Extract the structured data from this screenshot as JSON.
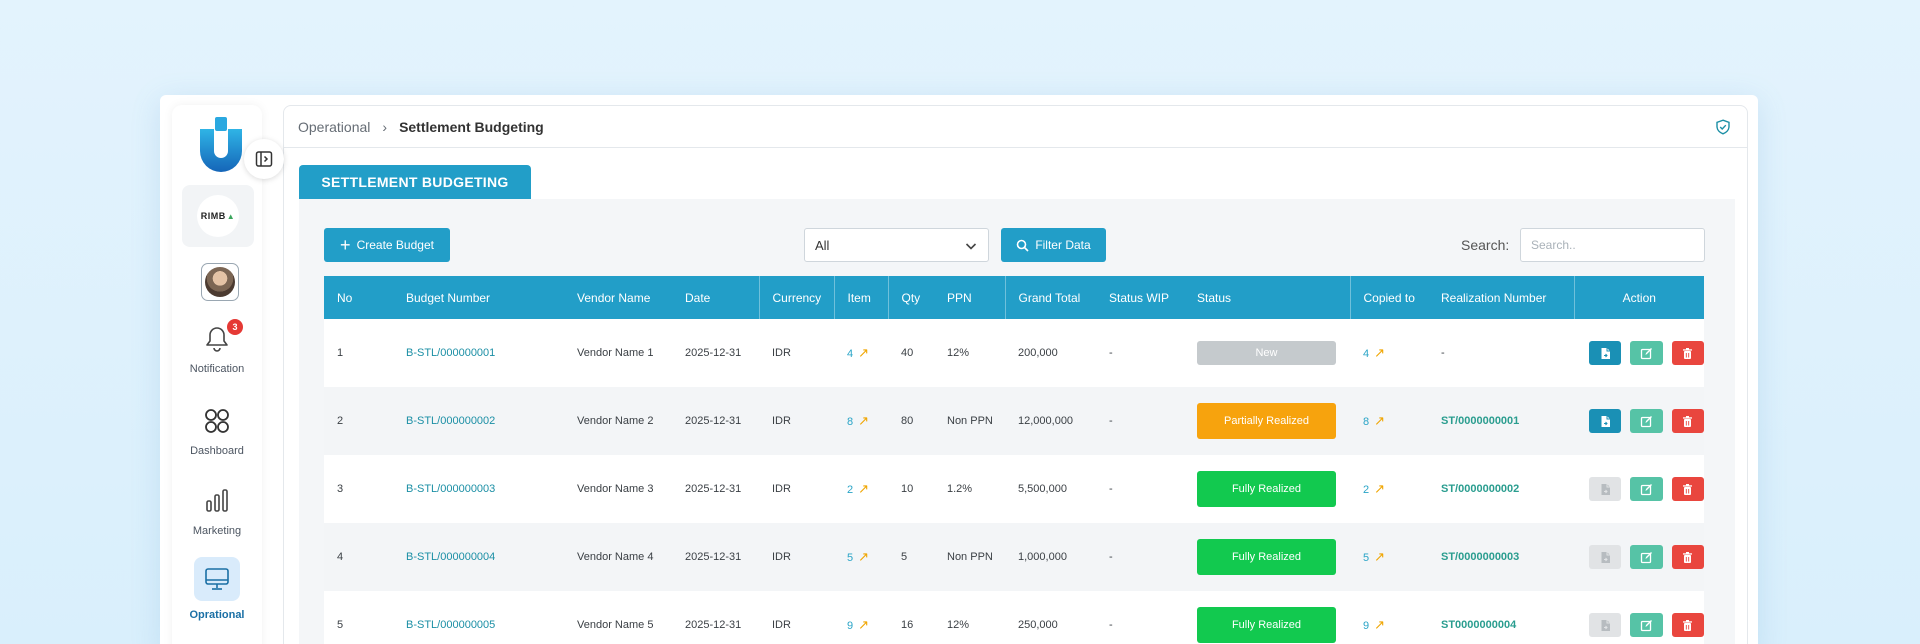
{
  "breadcrumb": {
    "parent": "Operational",
    "separator": "›",
    "current": "Settlement Budgeting"
  },
  "tab": {
    "label": "SETTLEMENT BUDGETING"
  },
  "sidebar": {
    "company_logo_text": "RIMB",
    "notification": {
      "label": "Notification",
      "badge": "3"
    },
    "items": [
      {
        "label": "Notification",
        "icon": "bell-icon"
      },
      {
        "label": "Dashboard",
        "icon": "grid-icon"
      },
      {
        "label": "Marketing",
        "icon": "bar-chart-icon"
      },
      {
        "label": "Oprational",
        "icon": "monitor-icon",
        "active": true
      }
    ]
  },
  "toolbar": {
    "create_label": "Create Budget",
    "select_value": "All",
    "filter_label": "Filter Data",
    "search_label": "Search:",
    "search_placeholder": "Search.."
  },
  "table": {
    "columns": [
      "No",
      "Budget Number",
      "Vendor Name",
      "Date",
      "Currency",
      "Item",
      "Qty",
      "PPN",
      "Grand Total",
      "Status WIP",
      "Status",
      "Copied to",
      "Realization Number",
      "Action"
    ],
    "rows": [
      {
        "no": "1",
        "budget": "B-STL/000000001",
        "vendor": "Vendor Name 1",
        "date": "2025-12-31",
        "currency": "IDR",
        "item": "4",
        "qty": "40",
        "ppn": "12%",
        "total": "200,000",
        "wip": "-",
        "status": "New",
        "copied": "4",
        "realization": "-",
        "doc_enabled": true
      },
      {
        "no": "2",
        "budget": "B-STL/000000002",
        "vendor": "Vendor Name 2",
        "date": "2025-12-31",
        "currency": "IDR",
        "item": "8",
        "qty": "80",
        "ppn": "Non PPN",
        "total": "12,000,000",
        "wip": "-",
        "status": "Partially Realized",
        "copied": "8",
        "realization": "ST/0000000001",
        "doc_enabled": true
      },
      {
        "no": "3",
        "budget": "B-STL/000000003",
        "vendor": "Vendor Name 3",
        "date": "2025-12-31",
        "currency": "IDR",
        "item": "2",
        "qty": "10",
        "ppn": "1.2%",
        "total": "5,500,000",
        "wip": "-",
        "status": "Fully Realized",
        "copied": "2",
        "realization": "ST/0000000002",
        "doc_enabled": false
      },
      {
        "no": "4",
        "budget": "B-STL/000000004",
        "vendor": "Vendor Name 4",
        "date": "2025-12-31",
        "currency": "IDR",
        "item": "5",
        "qty": "5",
        "ppn": "Non PPN",
        "total": "1,000,000",
        "wip": "-",
        "status": "Fully Realized",
        "copied": "5",
        "realization": "ST/0000000003",
        "doc_enabled": false
      },
      {
        "no": "5",
        "budget": "B-STL/000000005",
        "vendor": "Vendor Name 5",
        "date": "2025-12-31",
        "currency": "IDR",
        "item": "9",
        "qty": "16",
        "ppn": "12%",
        "total": "250,000",
        "wip": "-",
        "status": "Fully Realized",
        "copied": "9",
        "realization": "ST0000000004",
        "doc_enabled": false
      }
    ]
  },
  "colors": {
    "primary": "#229ec8",
    "new": "#c5cacd",
    "partial": "#f7a30d",
    "full": "#12c94f",
    "edit": "#56c3a6",
    "delete": "#e9463e"
  }
}
